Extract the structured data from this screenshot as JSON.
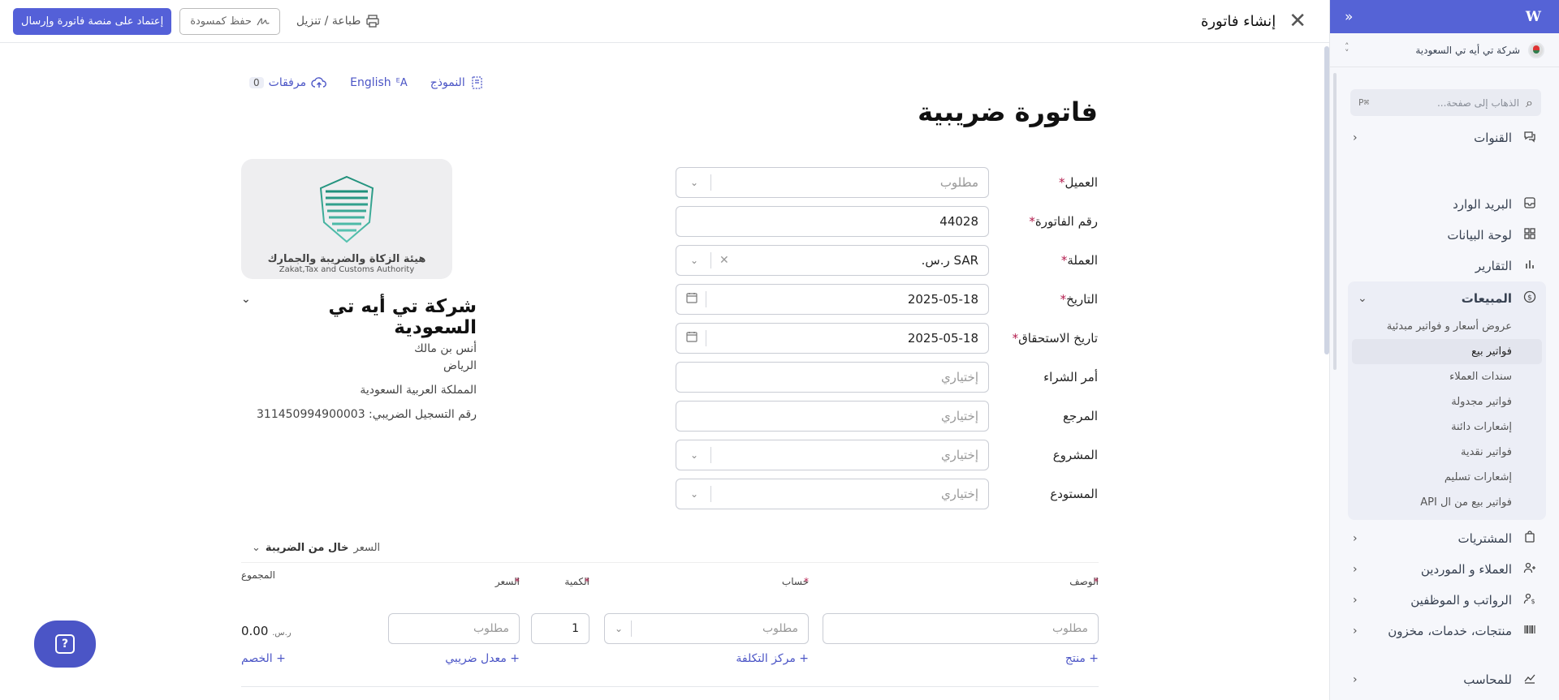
{
  "app": {
    "logo": "W",
    "collapse_icon": "double-chevron"
  },
  "sidebar": {
    "company": "شركة تي أيه تي السعودية",
    "search": {
      "placeholder": "الذهاب إلى صفحة...",
      "shortcut": "⌘P"
    },
    "nav_top": [
      {
        "label": "القنوات",
        "icon": "chat-icon"
      }
    ],
    "nav_main": [
      {
        "label": "البريد الوارد",
        "icon": "inbox-icon"
      },
      {
        "label": "لوحة البيانات",
        "icon": "dashboard-icon"
      },
      {
        "label": "التقارير",
        "icon": "reports-icon"
      }
    ],
    "sales": {
      "label": "المبيعات",
      "items": [
        "عروض أسعار و فواتير مبدئية",
        "فواتير بيع",
        "سندات العملاء",
        "فواتير مجدولة",
        "إشعارات دائنة",
        "فواتير نقدية",
        "إشعارات تسليم",
        "فواتير بيع من ال API"
      ],
      "active_index": 1
    },
    "nav_bottom": [
      {
        "label": "المشتريات",
        "icon": "bag-icon"
      },
      {
        "label": "العملاء و الموردين",
        "icon": "people-icon"
      },
      {
        "label": "الرواتب و الموظفين",
        "icon": "payroll-icon"
      },
      {
        "label": "منتجات، خدمات، مخزون",
        "icon": "barcode-icon"
      },
      {
        "label": "للمحاسب",
        "icon": "accountant-icon"
      }
    ]
  },
  "header": {
    "title": "إنشاء فاتورة",
    "print_label": "طباعة / تنزيل",
    "draft_label": "حفظ كمسودة",
    "submit_label": "إعتماد على منصة فاتورة وإرسال"
  },
  "toolbar": {
    "template_label": "النموذج",
    "language_label": "English",
    "attachments_label": "مرفقات",
    "attachments_count": "0"
  },
  "document": {
    "title": "فاتورة ضريبية"
  },
  "form": {
    "customer": {
      "label": "العميل",
      "placeholder": "مطلوب"
    },
    "invoice_number": {
      "label": "رقم الفاتورة",
      "value": "44028"
    },
    "currency": {
      "label": "العملة",
      "value": "SAR ر.س."
    },
    "date": {
      "label": "التاريخ",
      "value": "2025-05-18"
    },
    "due_date": {
      "label": "تاريخ الاستحقاق",
      "value": "2025-05-18"
    },
    "po": {
      "label": "أمر الشراء",
      "placeholder": "إختياري"
    },
    "reference": {
      "label": "المرجع",
      "placeholder": "إختياري"
    },
    "project": {
      "label": "المشروع",
      "placeholder": "إختياري"
    },
    "warehouse": {
      "label": "المستودع",
      "placeholder": "إختياري"
    }
  },
  "authority": {
    "name_ar": "هيئة الزكاة والضريبة والجمارك",
    "name_en": "Zakat,Tax and Customs Authority"
  },
  "company": {
    "name": "شركة تي أيه تي السعودية",
    "contact": "أنس بن مالك",
    "city": "الرياض",
    "country": "المملكة العربية السعودية",
    "vat": "رقم التسجيل الضريبي: 311450994900003"
  },
  "lines": {
    "price_mode_prefix": "السعر",
    "price_mode": "خال من الضريبة",
    "headers": {
      "description": "الوصف",
      "account": "حساب",
      "quantity": "الكمية",
      "price": "السعر",
      "total": "المجموع"
    },
    "row": {
      "description_placeholder": "مطلوب",
      "account_placeholder": "مطلوب",
      "quantity": "1",
      "price_placeholder": "مطلوب",
      "total": "0.00",
      "currency": "ر.س."
    },
    "links": {
      "add_product": "+ منتج",
      "cost_center": "+ مركز التكلفة",
      "tax_rate": "+ معدل ضريبي",
      "discount": "+ الخصم"
    }
  }
}
